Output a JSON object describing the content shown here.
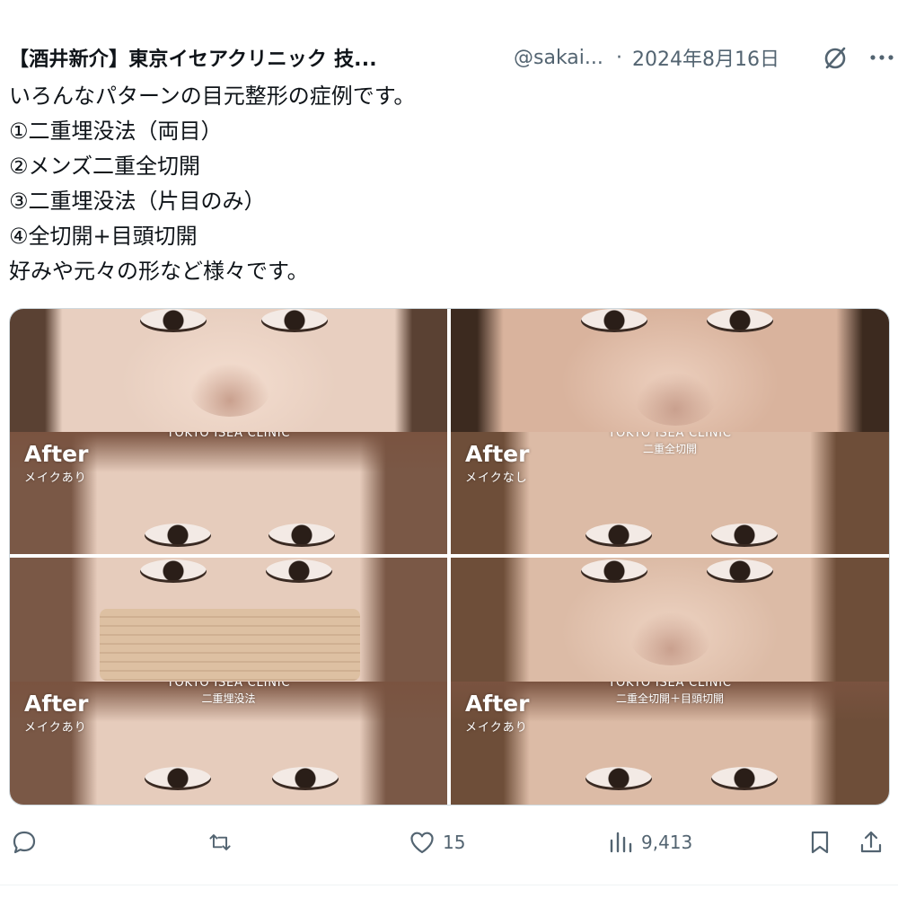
{
  "tweet": {
    "author_name": "【酒井新介】東京イセアクリニック 技...",
    "handle": "@sakai...",
    "separator": "·",
    "date": "2024年8月16日",
    "lines": [
      "いろんなパターンの目元整形の症例です。",
      "①二重埋没法（両目）",
      "②メンズ二重全切開",
      "③二重埋没法（片目のみ）",
      "④全切開+目頭切開",
      "好みや元々の形など様々です。"
    ]
  },
  "media": {
    "tiles": [
      {
        "after": "After",
        "after_sub": "メイクあり",
        "clinic": "TOKYO ISEA CLINIC",
        "procedure": ""
      },
      {
        "after": "After",
        "after_sub": "メイクなし",
        "clinic": "TOKYO ISEA CLINIC",
        "procedure": "二重全切開"
      },
      {
        "after": "After",
        "after_sub": "メイクあり",
        "clinic": "TOKYO ISEA CLINIC",
        "procedure": "二重埋没法"
      },
      {
        "after": "After",
        "after_sub": "メイクあり",
        "clinic": "TOKYO ISEA CLINIC",
        "procedure": "二重全切開＋目頭切開"
      }
    ]
  },
  "actions": {
    "reply_count": "",
    "retweet_count": "",
    "like_count": "15",
    "views_count": "9,413"
  },
  "icons": {
    "grok": "grok-icon",
    "more": "more-icon",
    "reply": "reply-icon",
    "retweet": "retweet-icon",
    "like": "heart-icon",
    "views": "views-icon",
    "bookmark": "bookmark-icon",
    "share": "share-icon"
  },
  "colors": {
    "text": "#0f1419",
    "secondary": "#536471",
    "border": "#cfd9de"
  }
}
